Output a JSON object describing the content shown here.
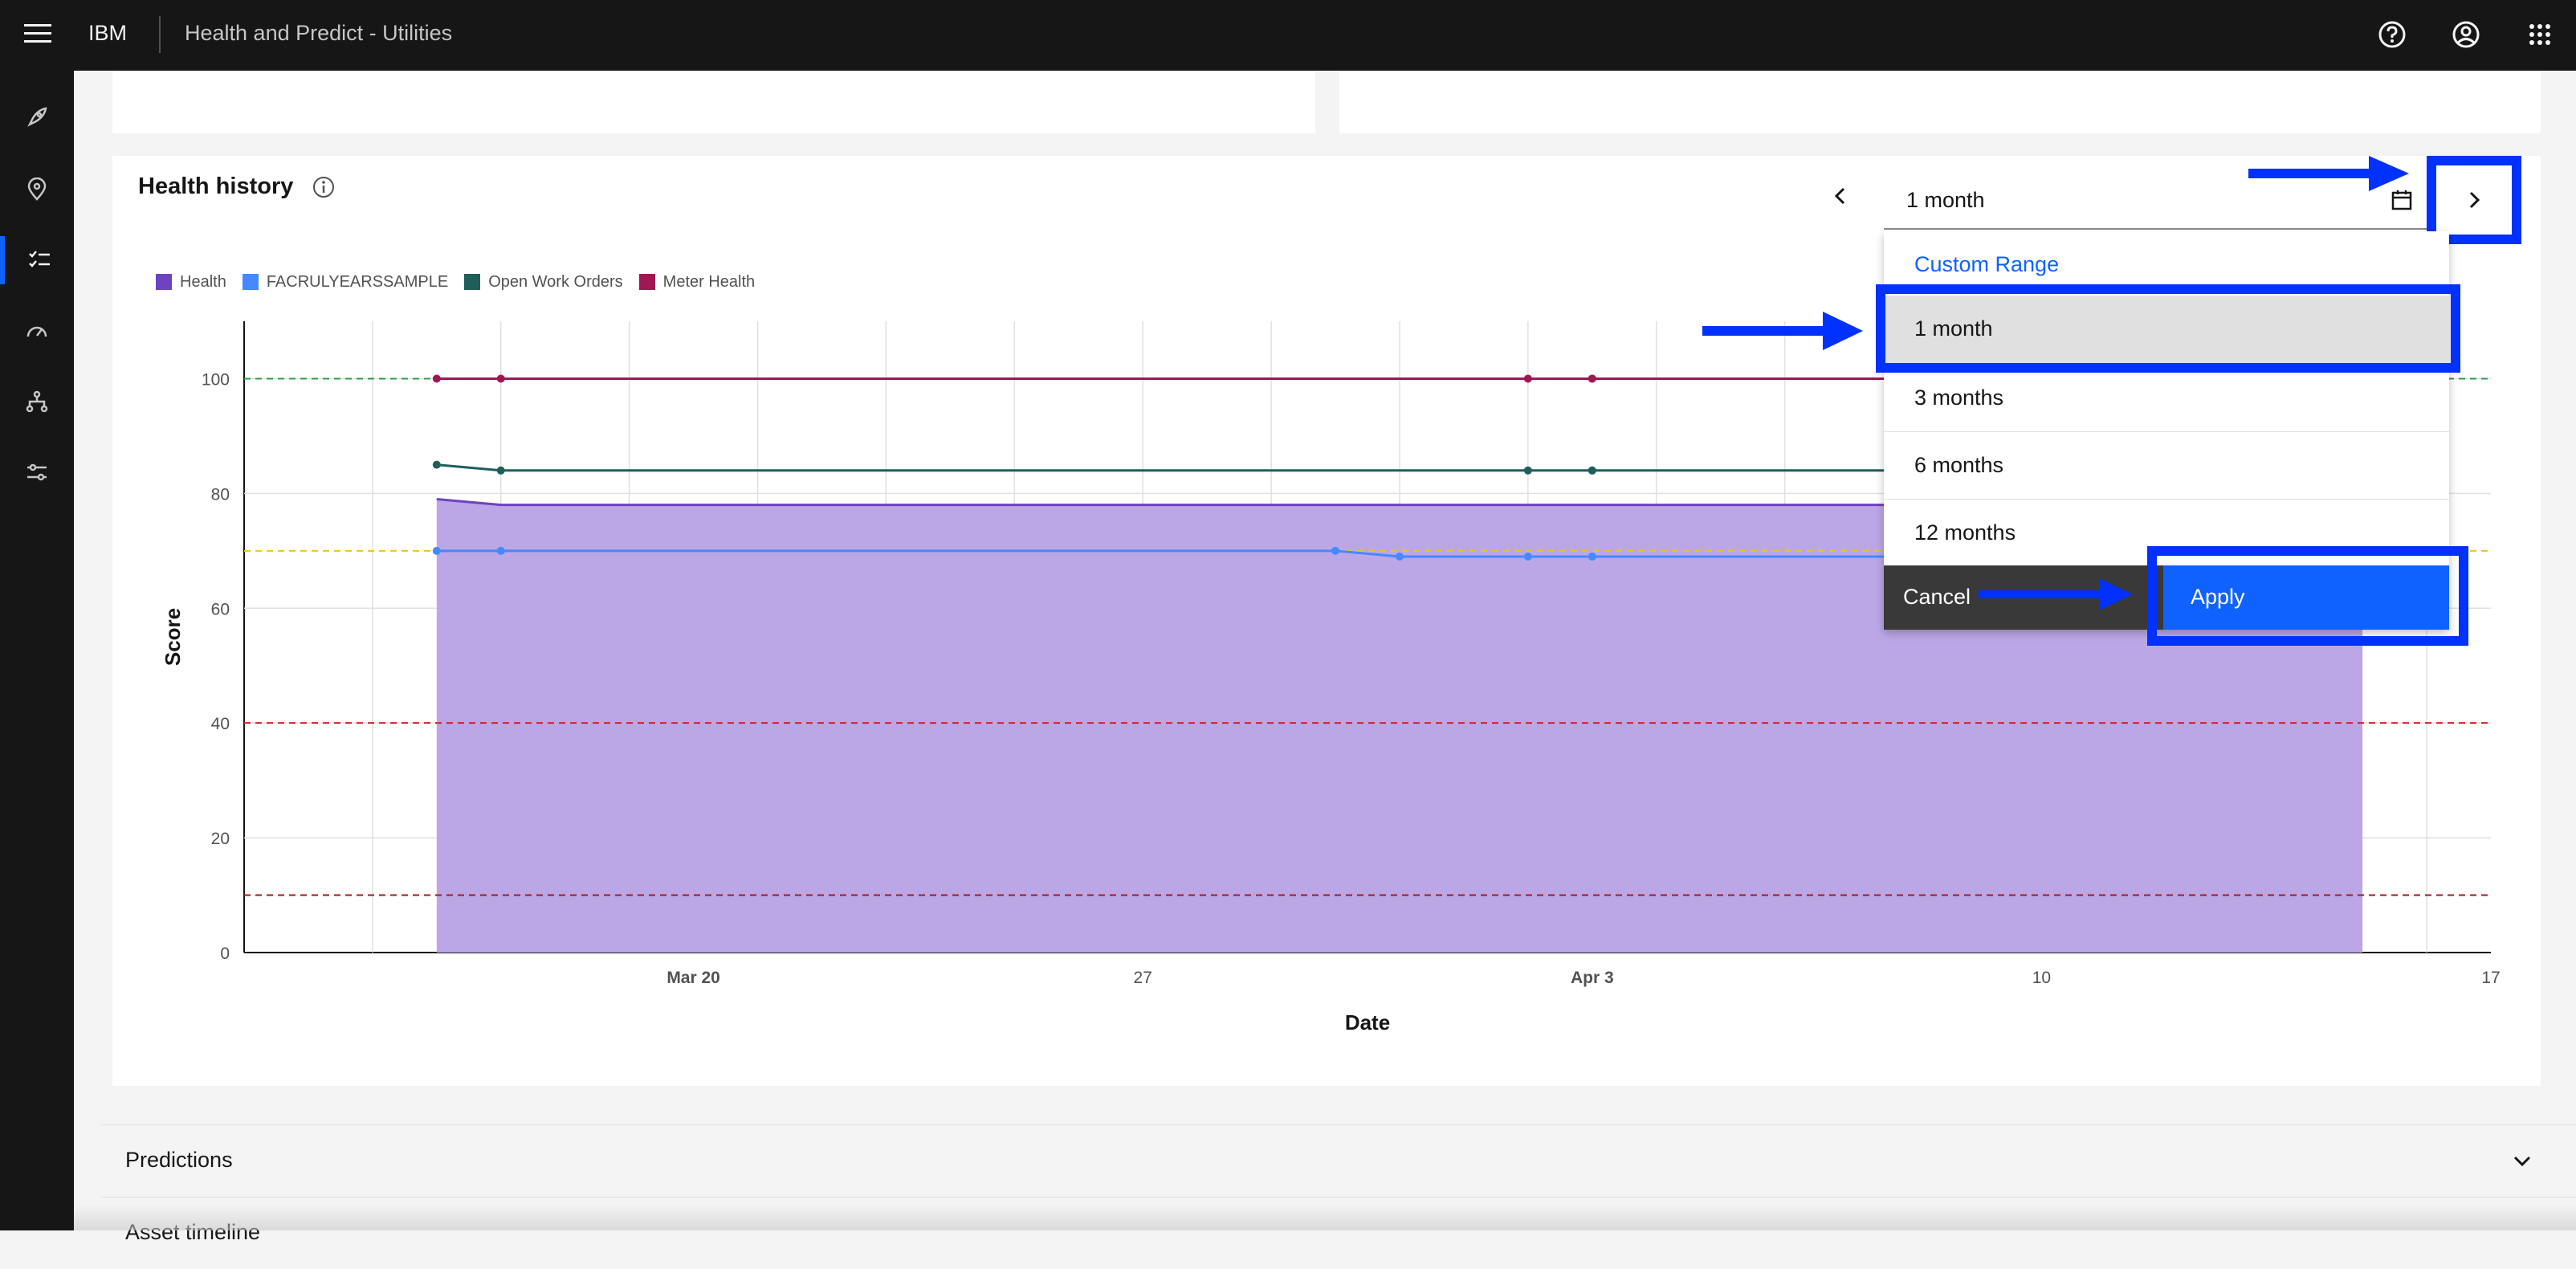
{
  "header": {
    "brand": "IBM",
    "app_title": "Health and Predict - Utilities"
  },
  "card": {
    "title": "Health history",
    "legend": [
      {
        "name": "Health",
        "color": "#6f42c1"
      },
      {
        "name": "FACRULYEARSSAMPLE",
        "color": "#4589ff"
      },
      {
        "name": "Open Work Orders",
        "color": "#1f5f5b"
      },
      {
        "name": "Meter Health",
        "color": "#9f1853"
      }
    ]
  },
  "range_picker": {
    "selected": "1 month",
    "custom_range": "Custom Range",
    "options": [
      "1 month",
      "3 months",
      "6 months",
      "12 months"
    ],
    "cancel": "Cancel",
    "apply": "Apply"
  },
  "accordions": [
    {
      "label": "Predictions"
    },
    {
      "label": "Asset timeline"
    }
  ],
  "chart_data": {
    "type": "area",
    "xlabel": "Date",
    "ylabel": "Score",
    "ylim": [
      0,
      100
    ],
    "y_ticks": [
      "0",
      "20",
      "40",
      "60",
      "80",
      "100"
    ],
    "x_tick_labels": [
      "Mar 20",
      "27",
      "Apr 3",
      "10",
      "17"
    ],
    "series": [
      {
        "name": "Health",
        "type": "area",
        "color": "#6f42c1",
        "x": [
          "Mar 16",
          "Mar 17",
          "Apr 15"
        ],
        "values": [
          79,
          78,
          78
        ]
      },
      {
        "name": "FACRULYEARSSAMPLE",
        "type": "line",
        "color": "#4589ff",
        "x": [
          "Mar 16",
          "Mar 17",
          "Mar 30",
          "Mar 31",
          "Apr 2",
          "Apr 3",
          "Apr 3",
          "Apr 14"
        ],
        "values": [
          70,
          70,
          70,
          69,
          69,
          69,
          69,
          69
        ]
      },
      {
        "name": "Open Work Orders",
        "type": "line",
        "color": "#1f5f5b",
        "x": [
          "Mar 16",
          "Mar 17",
          "Apr 2",
          "Apr 3",
          "Apr 3",
          "Apr 14"
        ],
        "values": [
          85,
          84,
          84,
          84,
          84,
          84
        ]
      },
      {
        "name": "Meter Health",
        "type": "line",
        "color": "#9f1853",
        "x": [
          "Mar 16",
          "Mar 17",
          "Apr 2",
          "Apr 3",
          "Apr 3",
          "Apr 14"
        ],
        "values": [
          100,
          100,
          100,
          100,
          100,
          100
        ]
      }
    ],
    "thresholds": [
      {
        "value": 100,
        "color": "#24a148"
      },
      {
        "value": 70,
        "color": "#f1c21b"
      },
      {
        "value": 40,
        "color": "#da1e28"
      },
      {
        "value": 10,
        "color": "#a2191f"
      }
    ],
    "grid": true
  },
  "colors": {
    "accent": "#0f62fe",
    "annotation": "#0031ff",
    "topbar": "#161616"
  },
  "icons": {
    "top": [
      "help-icon",
      "user-avatar-icon",
      "app-switcher-icon"
    ],
    "sidenav": [
      "rocket-icon",
      "location-icon",
      "checklist-icon",
      "gauge-icon",
      "hierarchy-icon",
      "settings-adjust-icon"
    ]
  }
}
